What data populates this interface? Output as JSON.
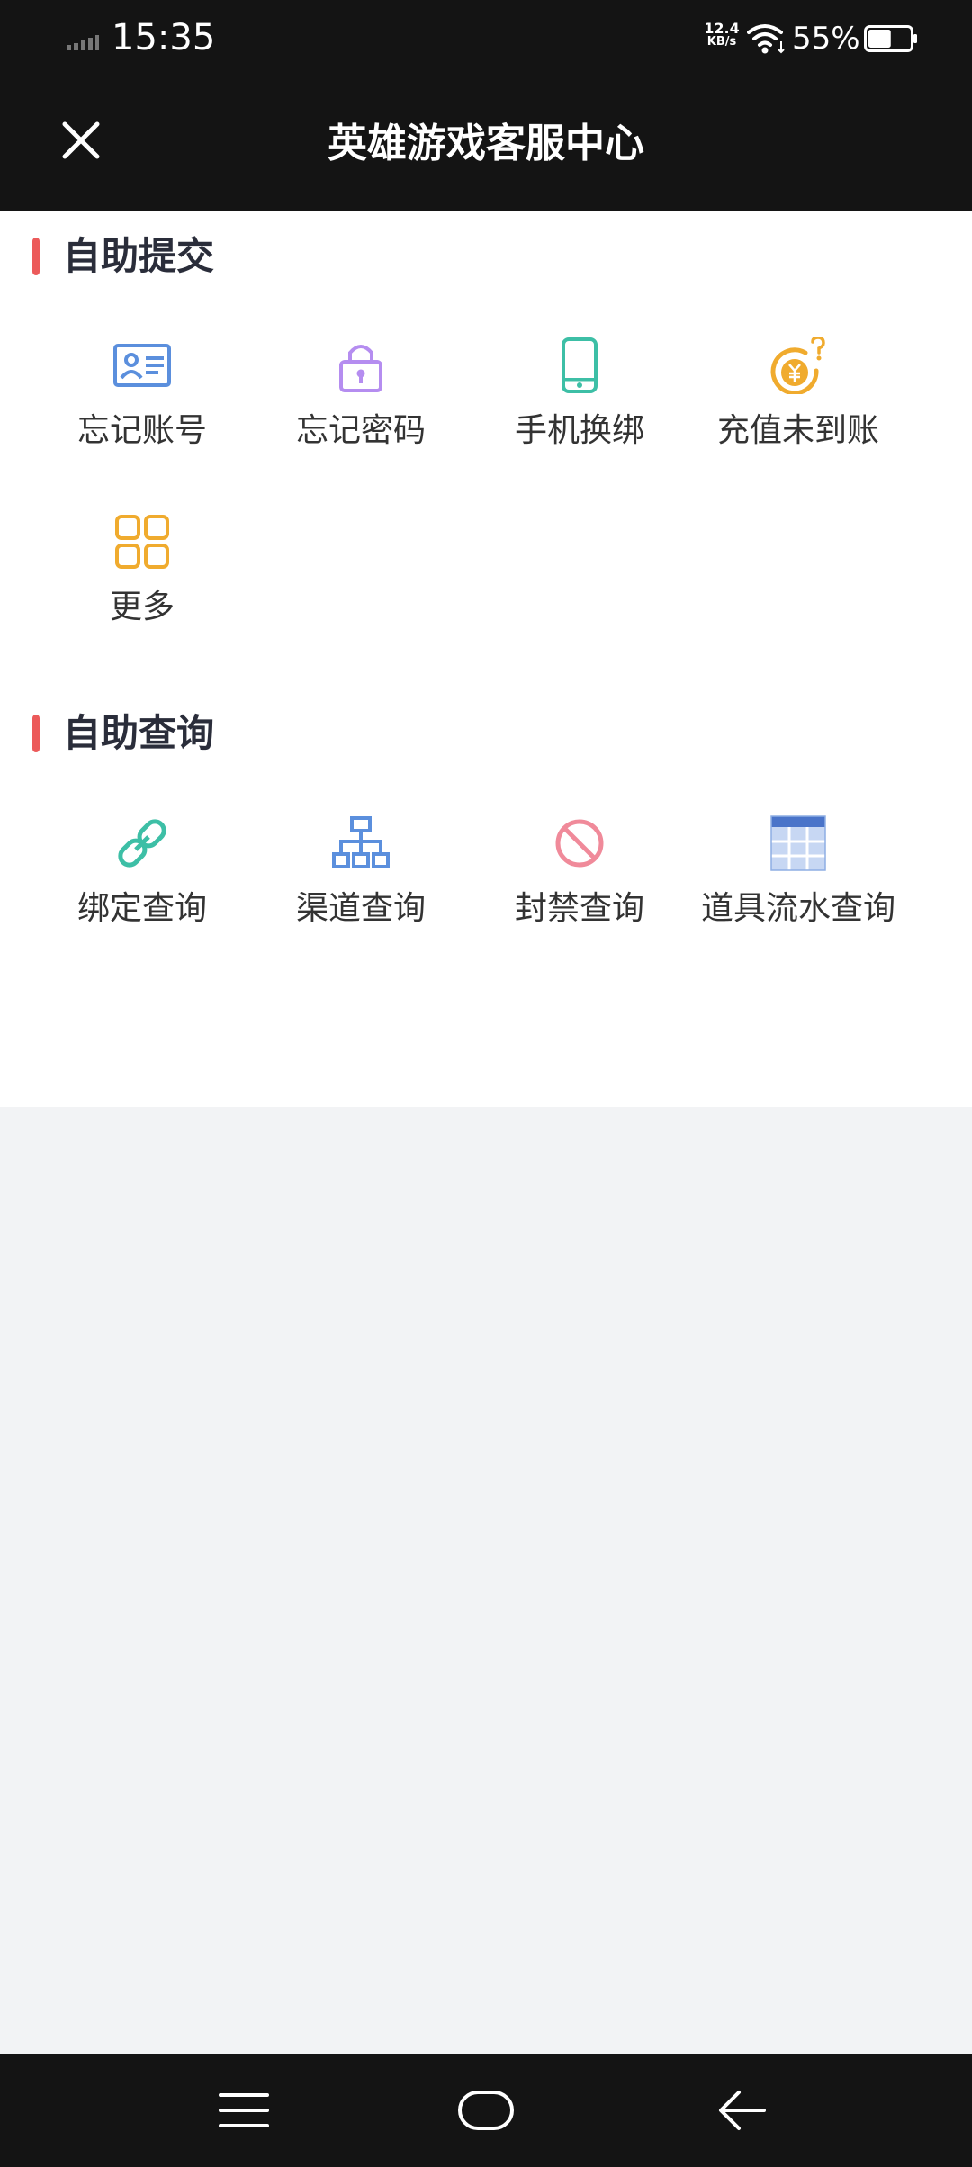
{
  "status_bar": {
    "time": "15:35",
    "net_speed_value": "12.4",
    "net_speed_unit": "KB/s",
    "battery_percent": "55%",
    "battery_level": 0.55
  },
  "header": {
    "title": "英雄游戏客服中心",
    "close_icon": "close-icon"
  },
  "sections": [
    {
      "title": "自助提交",
      "items": [
        {
          "label": "忘记账号",
          "icon": "id-card-icon",
          "color": "#5b8fdd"
        },
        {
          "label": "忘记密码",
          "icon": "lock-icon",
          "color": "#b58df0"
        },
        {
          "label": "手机换绑",
          "icon": "phone-icon",
          "color": "#3dbfa6"
        },
        {
          "label": "充值未到账",
          "icon": "yuan-coin-question-icon",
          "color": "#f0ab2e"
        },
        {
          "label": "更多",
          "icon": "grid-icon",
          "color": "#f0ab2e"
        }
      ]
    },
    {
      "title": "自助查询",
      "items": [
        {
          "label": "绑定查询",
          "icon": "link-icon",
          "color": "#3dbfa6"
        },
        {
          "label": "渠道查询",
          "icon": "org-chart-icon",
          "color": "#5b8fdd"
        },
        {
          "label": "封禁查询",
          "icon": "ban-icon",
          "color": "#f08a9a"
        },
        {
          "label": "道具流水查询",
          "icon": "table-icon",
          "color": "#5b8fdd"
        }
      ]
    }
  ],
  "colors": {
    "bar_background": "#141414",
    "accent": "#ec5a5a",
    "page_background": "#f2f3f5"
  },
  "nav": {
    "menu_icon": "menu-icon",
    "home_icon": "home-icon",
    "back_icon": "back-arrow-icon"
  }
}
